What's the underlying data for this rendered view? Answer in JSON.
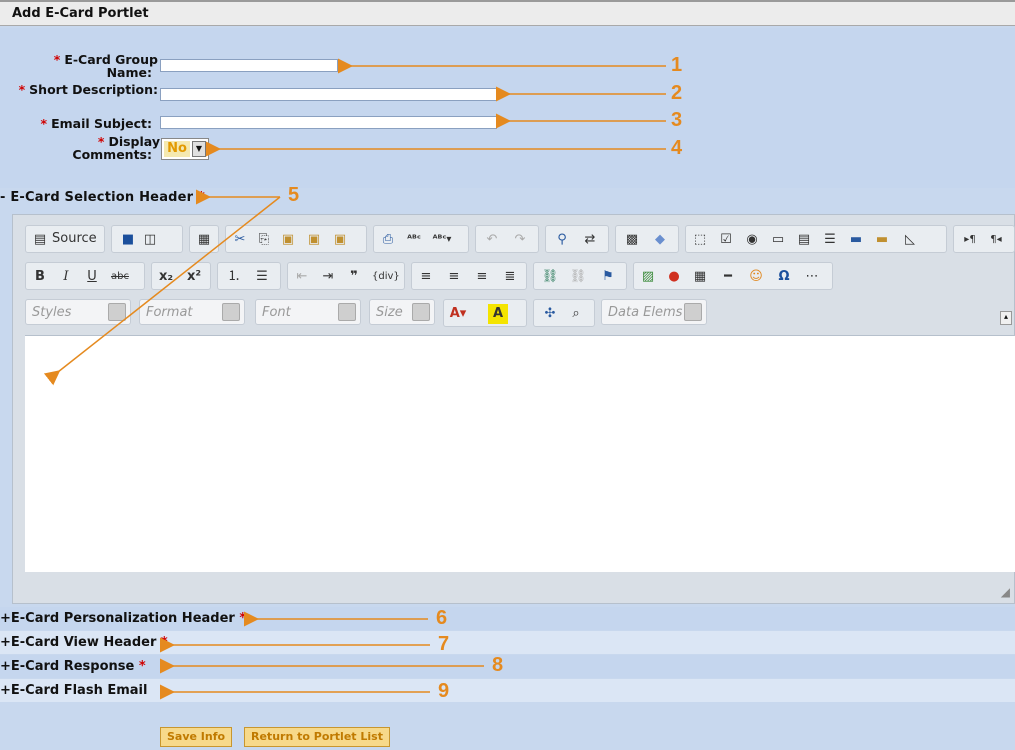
{
  "page": {
    "title": "Add E-Card Portlet"
  },
  "form": {
    "group_name_label": "E-Card Group Name:",
    "group_name_line1": "E-Card Group",
    "group_name_line2": "Name:",
    "short_desc_label": "Short Description:",
    "email_subject_label": "Email Subject:",
    "display_comments_line1": "Display",
    "display_comments_line2": "Comments:",
    "display_comments_value": "No",
    "required_mark": "*",
    "group_name_value": "",
    "short_desc_value": "",
    "email_subject_value": ""
  },
  "sections": {
    "selection_header": "- E-Card Selection Header",
    "personalization_header": "+E-Card Personalization Header",
    "view_header": "+E-Card View Header",
    "response": "+E-Card Response",
    "flash_email": "+E-Card Flash Email"
  },
  "editor": {
    "source_label": "Source",
    "styles_placeholder": "Styles",
    "format_placeholder": "Format",
    "font_placeholder": "Font",
    "size_placeholder": "Size",
    "data_elems_placeholder": "Data Elems"
  },
  "buttons": {
    "save": "Save Info",
    "return": "Return to Portlet List"
  },
  "annotations": [
    "1",
    "2",
    "3",
    "4",
    "5",
    "6",
    "7",
    "8",
    "9"
  ],
  "colors": {
    "annotation": "#e58a1f",
    "required": "#d00000",
    "background": "#c8d8ee"
  }
}
